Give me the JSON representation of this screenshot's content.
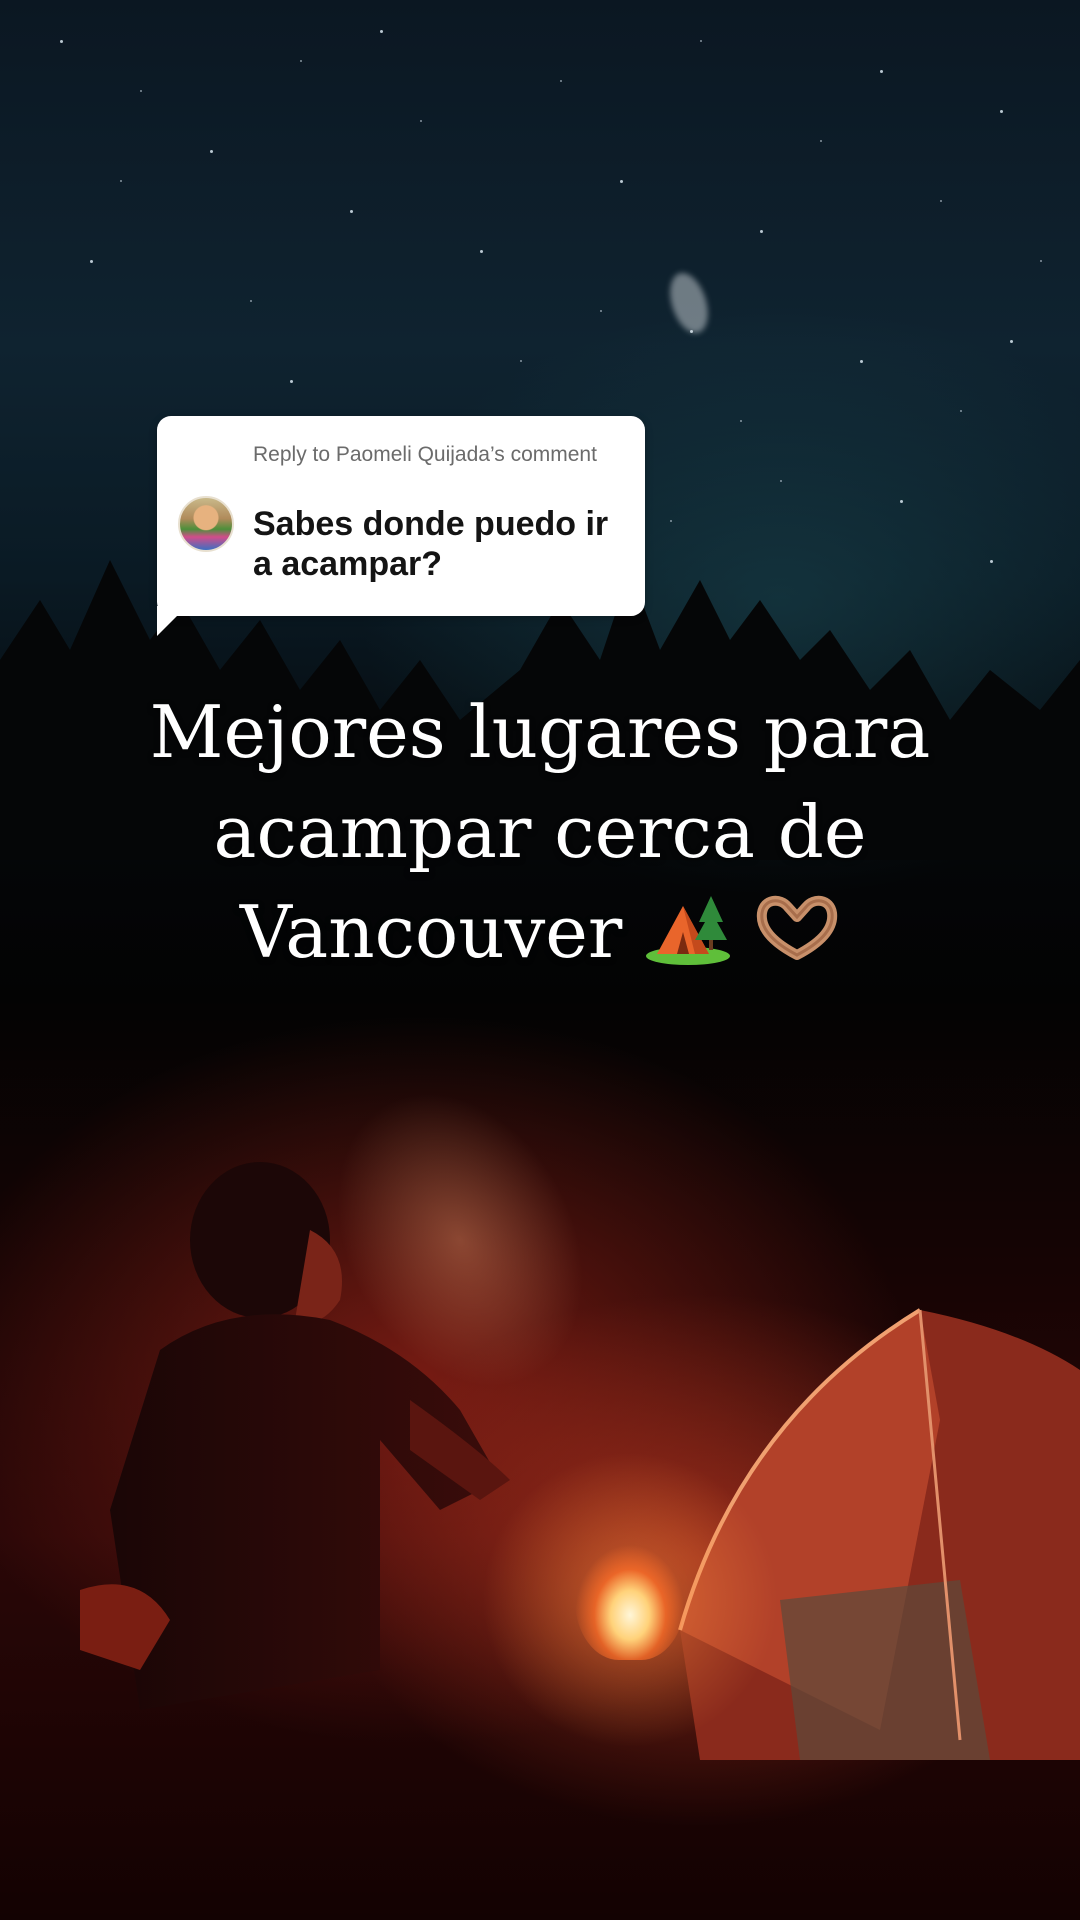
{
  "reply_card": {
    "label": "Reply to Paomeli Quijada’s comment",
    "comment": "Sabes donde puedo ir a acampar?"
  },
  "headline": {
    "line1": "Mejores lugares para",
    "line2": "acampar cerca de",
    "line3_text": "Vancouver",
    "emojis": [
      "camping-tent-icon",
      "heart-hands-icon"
    ]
  },
  "colors": {
    "card_bg": "#ffffff",
    "label_gray": "#6b6b6b",
    "headline_white": "#ffffff",
    "ember_red": "#c0391f"
  }
}
